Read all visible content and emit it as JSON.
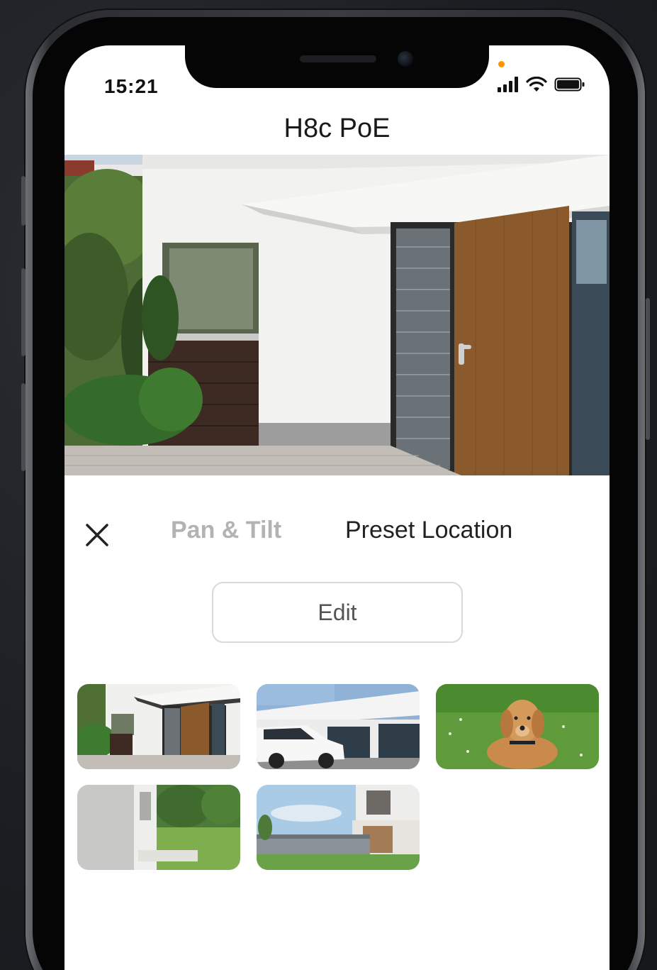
{
  "status_bar": {
    "time": "15:21"
  },
  "header": {
    "title": "H8c PoE"
  },
  "tabs": [
    {
      "label": "Pan & Tilt",
      "active": false
    },
    {
      "label": "Preset Location",
      "active": true
    }
  ],
  "edit_button": {
    "label": "Edit"
  },
  "presets": [
    {
      "scene": "house-entrance-door"
    },
    {
      "scene": "white-car-garage"
    },
    {
      "scene": "dog-on-lawn"
    },
    {
      "scene": "side-yard-lawn"
    },
    {
      "scene": "modern-house-pool"
    }
  ],
  "colors": {
    "accent_orange": "#ff9500",
    "tab_active": "#222222",
    "tab_inactive": "#b3b3b3"
  },
  "icons": [
    "close-icon",
    "signal-icon",
    "wifi-icon",
    "battery-icon"
  ]
}
